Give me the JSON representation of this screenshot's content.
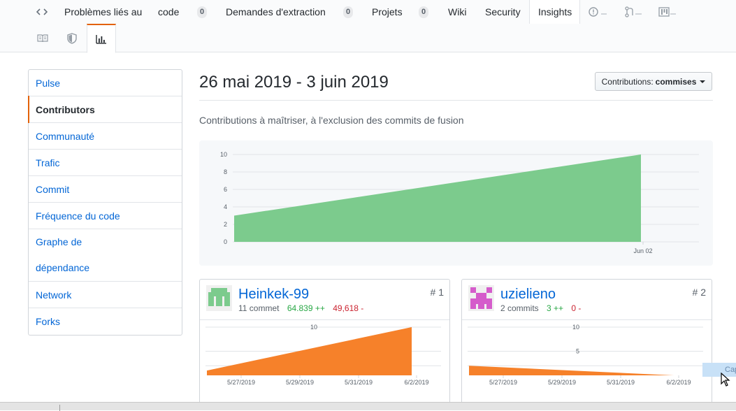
{
  "nav": {
    "code_label": "code",
    "code_count": "0",
    "issues_label": "Problèmes liés au",
    "pulls_label": "Demandes d'extraction",
    "pulls_count": "0",
    "projects_label": "Projets",
    "projects_count": "0",
    "wiki_label": "Wiki",
    "security_label": "Security",
    "insights_label": "Insights"
  },
  "sidebar": {
    "items": [
      {
        "label": "Pulse"
      },
      {
        "label": "Contributors"
      },
      {
        "label": "Communauté"
      },
      {
        "label": "Trafic"
      },
      {
        "label": "Commit"
      },
      {
        "label": "Fréquence du code"
      },
      {
        "label": "Graphe de"
      },
      {
        "label": "dépendance"
      },
      {
        "label": "Network"
      },
      {
        "label": "Forks"
      }
    ]
  },
  "main": {
    "title": "26 mai 2019 - 3 juin 2019",
    "dropdown_prefix": "Contributions:",
    "dropdown_value": "commises",
    "subtitle": "Contributions à maîtriser, à l'exclusion des commits de fusion"
  },
  "contributors": [
    {
      "name": "Heinkek-99",
      "commits": "11 commet",
      "additions": "64.839 ++",
      "deletions": "49,618 -",
      "rank": "# 1"
    },
    {
      "name": "uzielieno",
      "commits": "2 commits",
      "additions": "3 ++",
      "deletions": "0 -",
      "rank": "# 2"
    }
  ],
  "overlay": {
    "capture_label": "Cap"
  },
  "colors": {
    "accent": "#e36209",
    "link": "#0366d6",
    "main_area": "#7ccb8d",
    "contrib_area": "#f6812a"
  },
  "chart_data": [
    {
      "type": "area",
      "x": [
        "2019-05-26",
        "2019-06-02"
      ],
      "values": [
        3,
        10
      ],
      "x_tick_labels": [
        "Jun 02"
      ],
      "y_ticks": [
        "0",
        "2",
        "4",
        "6",
        "8",
        "10"
      ],
      "ylim": [
        0,
        10
      ],
      "grid": true
    },
    {
      "type": "area",
      "x": [
        "2019-05-26",
        "2019-06-02"
      ],
      "values": [
        1,
        10
      ],
      "x_tick_labels": [
        "5/27/2019",
        "5/29/2019",
        "5/31/2019",
        "6/2/2019"
      ],
      "y_ticks": [
        "10"
      ],
      "ylim": [
        0,
        10
      ],
      "grid": true
    },
    {
      "type": "area",
      "x": [
        "2019-05-26",
        "2019-06-02"
      ],
      "values": [
        2,
        0
      ],
      "x_tick_labels": [
        "5/27/2019",
        "5/29/2019",
        "5/31/2019",
        "6/2/2019"
      ],
      "y_ticks": [
        "10",
        "5"
      ],
      "ylim": [
        0,
        10
      ],
      "grid": true
    }
  ]
}
